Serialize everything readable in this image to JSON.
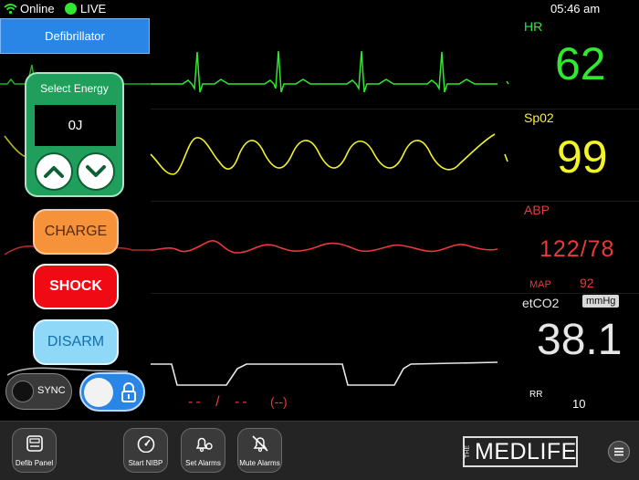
{
  "status": {
    "connection": "Online",
    "live": "LIVE",
    "time": "05:46 am"
  },
  "vitals": {
    "hr": {
      "label": "HR",
      "value": "62",
      "color": "#2fe82f"
    },
    "spo2": {
      "label": "Sp02",
      "value": "99",
      "color": "#f3f32a"
    },
    "abp": {
      "label": "ABP",
      "value": "122/78",
      "map_label": "MAP",
      "map_value": "92",
      "color": "#e83a3a"
    },
    "etco2": {
      "label": "etCO2",
      "unit": "mmHg",
      "value": "38.1",
      "rr_label": "RR",
      "rr_value": "10",
      "color": "#e6e6e6"
    },
    "nibp_placeholder": {
      "value": "-- / --",
      "map": "(--)"
    }
  },
  "defib": {
    "title": "Defibrillator",
    "energy_label": "Select Energy",
    "energy_value": "0J",
    "charge": "CHARGE",
    "shock": "SHOCK",
    "disarm": "DISARM",
    "sync": "SYNC"
  },
  "toolbar": {
    "defib_panel": "Defib Panel",
    "start_nibp": "Start NIBP",
    "set_alarms": "Set Alarms",
    "mute_alarms": "Mute Alarms"
  },
  "logo": {
    "left": "THE",
    "main": "MEDLIFE"
  },
  "icons": [
    "wifi-icon",
    "live-dot-icon",
    "chevron-up-icon",
    "chevron-down-icon",
    "lock-icon",
    "defib-icon",
    "gauge-icon",
    "bell-gear-icon",
    "bell-mute-icon",
    "menu-icon"
  ]
}
